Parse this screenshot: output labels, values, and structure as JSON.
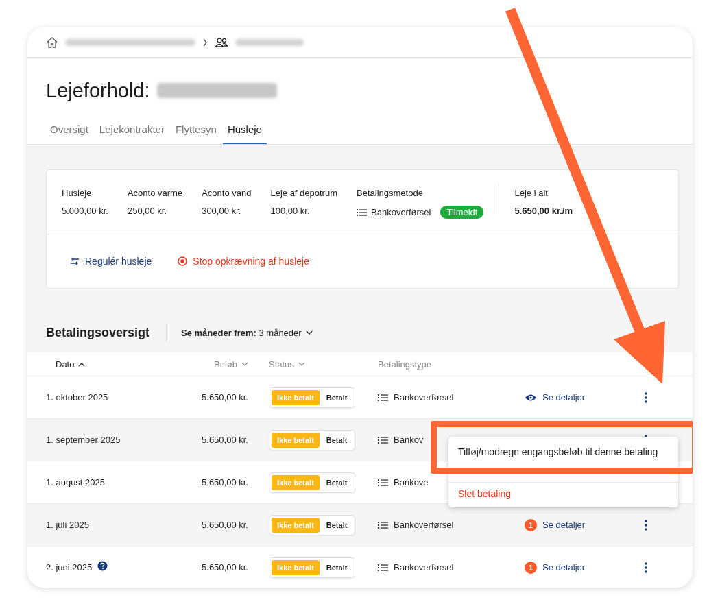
{
  "page": {
    "title": "Lejeforhold:"
  },
  "tabs": [
    {
      "label": "Oversigt",
      "selected": false
    },
    {
      "label": "Lejekontrakter",
      "selected": false
    },
    {
      "label": "Flyttesyn",
      "selected": false
    },
    {
      "label": "Husleje",
      "selected": true
    }
  ],
  "summary": {
    "fields": [
      {
        "label": "Husleje",
        "value": "5.000,00 kr."
      },
      {
        "label": "Aconto varme",
        "value": "250,00 kr."
      },
      {
        "label": "Aconto vand",
        "value": "300,00 kr."
      },
      {
        "label": "Leje af depotrum",
        "value": "100,00 kr."
      }
    ],
    "payment_method": {
      "label": "Betalingsmetode",
      "value": "Bankoverførsel",
      "badge": "Tilmeldt"
    },
    "total": {
      "label": "Leje i alt",
      "value": "5.650,00 kr./m"
    },
    "actions": [
      {
        "kind": "adjust",
        "label": "Regulér husleje"
      },
      {
        "kind": "stop",
        "label": "Stop opkrævning af husleje"
      }
    ]
  },
  "payments": {
    "title": "Betalingsoversigt",
    "months_filter": "**Se måneder frem:** 3 måneder",
    "columns": [
      {
        "label": "Dato",
        "sortable": true,
        "active": true
      },
      {
        "label": "Beløb",
        "sortable": true,
        "active": false
      },
      {
        "label": "Status",
        "sortable": true,
        "active": false
      },
      {
        "label": "Betalingstype",
        "sortable": false,
        "active": false
      }
    ],
    "rows": [
      {
        "date": "1. oktober 2025",
        "help": false,
        "amount": "5.650,00 kr.",
        "status": [
          {
            "label": "Ikke betalt",
            "selected": true
          },
          {
            "label": "Betalt",
            "selected": false
          }
        ],
        "type": "Bankoverførsel",
        "details": {
          "kind": "eye",
          "label": "Se detaljer"
        },
        "menu_button": true
      },
      {
        "date": "1. september 2025",
        "help": false,
        "amount": "5.650,00 kr.",
        "status": [
          {
            "label": "Ikke betalt",
            "selected": true
          },
          {
            "label": "Betalt",
            "selected": false
          }
        ],
        "type": "Bankov",
        "menu_button": true
      },
      {
        "date": "1. august 2025",
        "help": false,
        "amount": "5.650,00 kr.",
        "status": [
          {
            "label": "Ikke betalt",
            "selected": true
          },
          {
            "label": "Betalt",
            "selected": false
          }
        ],
        "type": "Bankove",
        "menu_button": false
      },
      {
        "date": "1. juli 2025",
        "help": false,
        "amount": "5.650,00 kr.",
        "status": [
          {
            "label": "Ikke betalt",
            "selected": true
          },
          {
            "label": "Betalt",
            "selected": false
          }
        ],
        "type": "Bankoverførsel",
        "details": {
          "kind": "badge",
          "count": "1",
          "label": "Se detaljer"
        },
        "menu_button": true
      },
      {
        "date": "2. juni 2025",
        "help": true,
        "amount": "5.650,00 kr.",
        "status": [
          {
            "label": "Ikke betalt",
            "selected": true
          },
          {
            "label": "Betalt",
            "selected": false
          }
        ],
        "type": "Bankoverførsel",
        "details": {
          "kind": "badge",
          "count": "1",
          "label": "Se detaljer"
        },
        "menu_button": true
      }
    ],
    "menu": [
      {
        "kind": "normal",
        "label": "Tilføj/modregn engangsbeløb til denne betaling"
      },
      {
        "kind": "hidden"
      },
      {
        "kind": "danger",
        "label": "Slet betaling"
      }
    ]
  }
}
